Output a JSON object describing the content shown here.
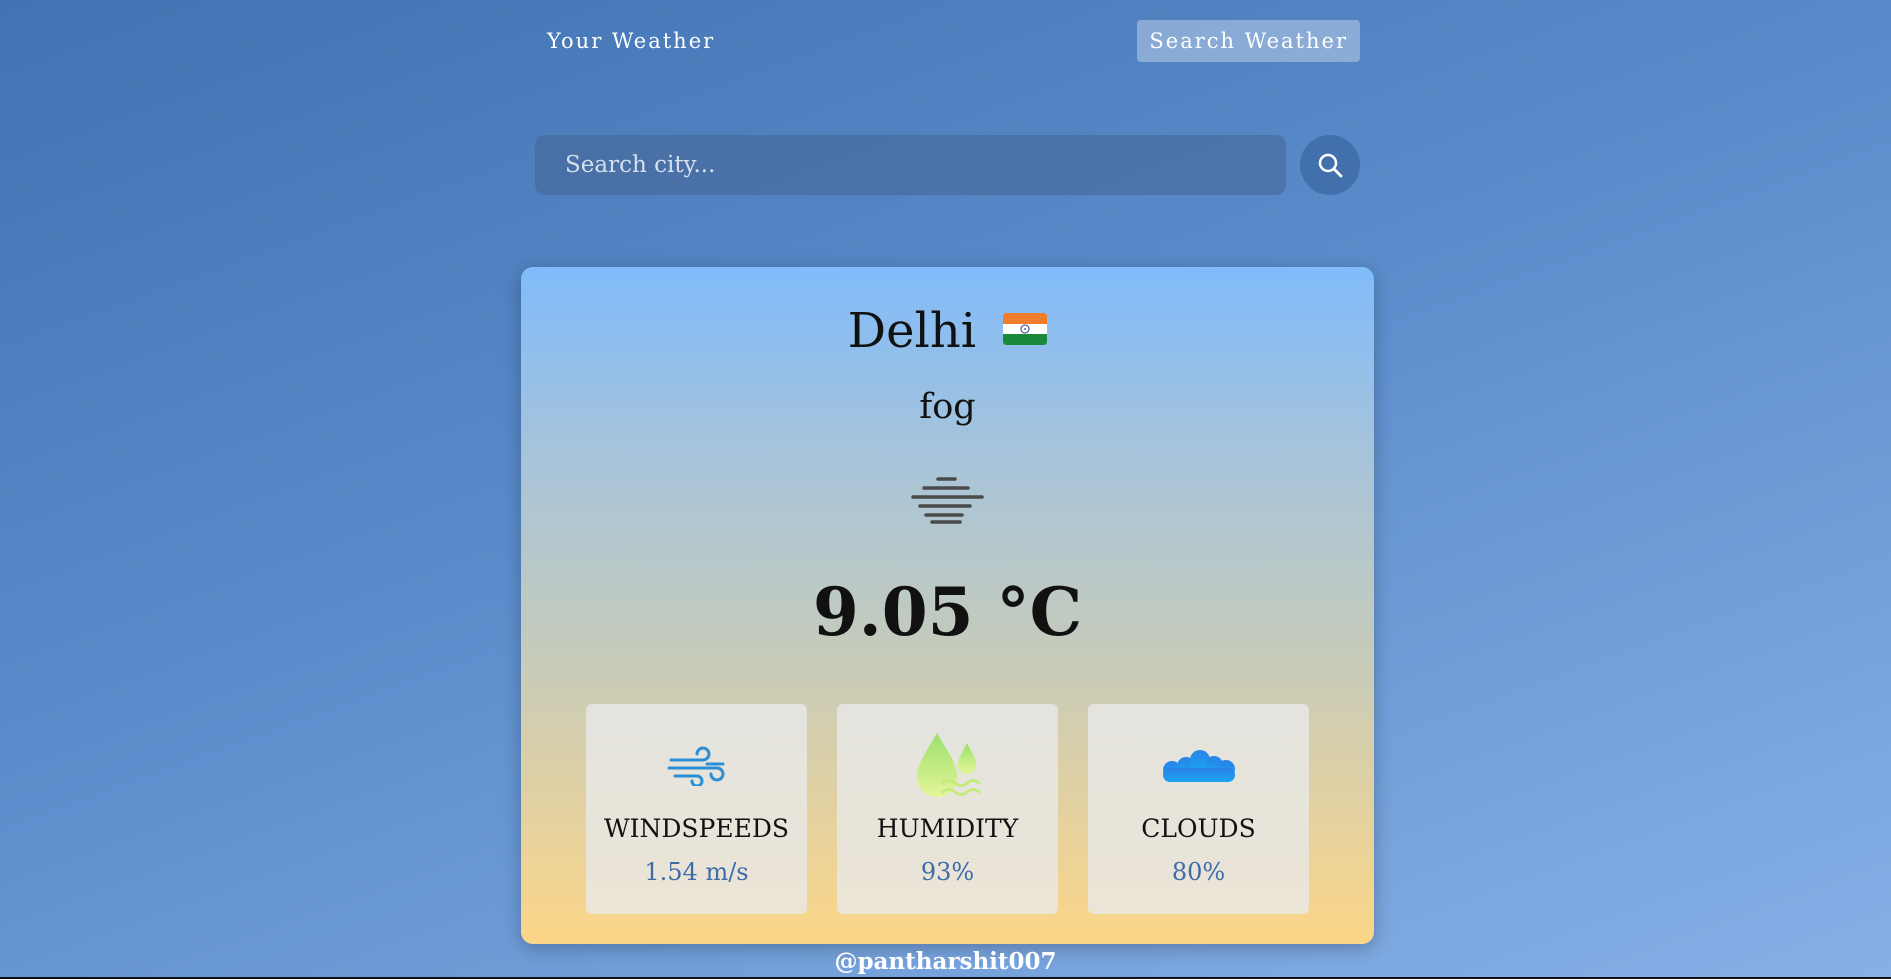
{
  "nav": {
    "your_weather": "Your Weather",
    "search_weather": "Search Weather"
  },
  "search": {
    "placeholder": "Search city..."
  },
  "weather": {
    "city": "Delhi",
    "country_flag": "india-flag",
    "condition": "fog",
    "condition_icon": "fog-icon",
    "temperature": "9.05 °C"
  },
  "stats": [
    {
      "icon": "wind-icon",
      "label": "WINDSPEEDS",
      "value": "1.54 m/s"
    },
    {
      "icon": "humidity-icon",
      "label": "HUMIDITY",
      "value": "93%"
    },
    {
      "icon": "clouds-icon",
      "label": "CLOUDS",
      "value": "80%"
    }
  ],
  "footer": {
    "credit": "@pantharshit007"
  },
  "colors": {
    "accent": "#4270ad",
    "value_text": "#3d6ca8"
  }
}
